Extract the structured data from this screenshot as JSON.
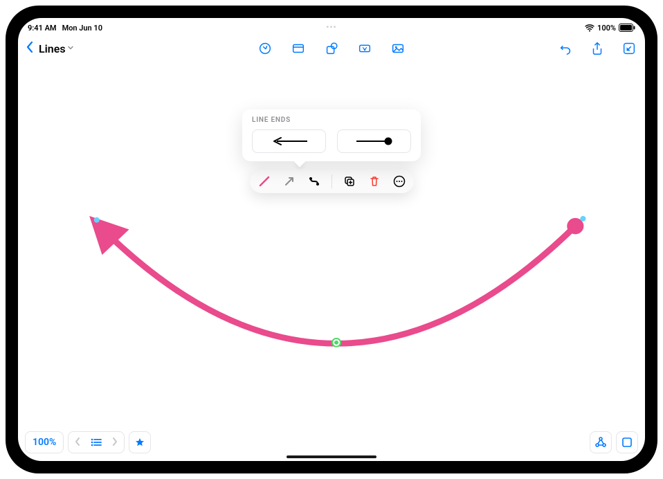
{
  "status": {
    "time": "9:41 AM",
    "date": "Mon Jun 10",
    "battery": "100%"
  },
  "toolbar": {
    "doc_title": "Lines"
  },
  "popover": {
    "title": "LINE ENDS"
  },
  "bottom": {
    "zoom": "100%"
  },
  "colors": {
    "accent": "#007aff",
    "pink": "#e94b8c",
    "red": "#ff3b30"
  },
  "icons": {
    "back": "chevron-left",
    "paint": "paint-circle",
    "slide": "slide-rect",
    "shape": "shape-box",
    "textbox": "text-box",
    "image": "image-rect",
    "undo": "undo-arrow",
    "share": "share-up",
    "edit": "edit-pencil-square",
    "stroke": "stroke-line",
    "arrow": "arrow-diag",
    "connect": "connect-curve",
    "duplicate": "duplicate-plus",
    "delete": "trash",
    "more": "ellipsis-circle",
    "zoom_prev": "chevron-left",
    "zoom_list": "list-bullet",
    "zoom_next": "chevron-right",
    "favorite": "star",
    "collab": "collab-network",
    "present": "present-square"
  }
}
